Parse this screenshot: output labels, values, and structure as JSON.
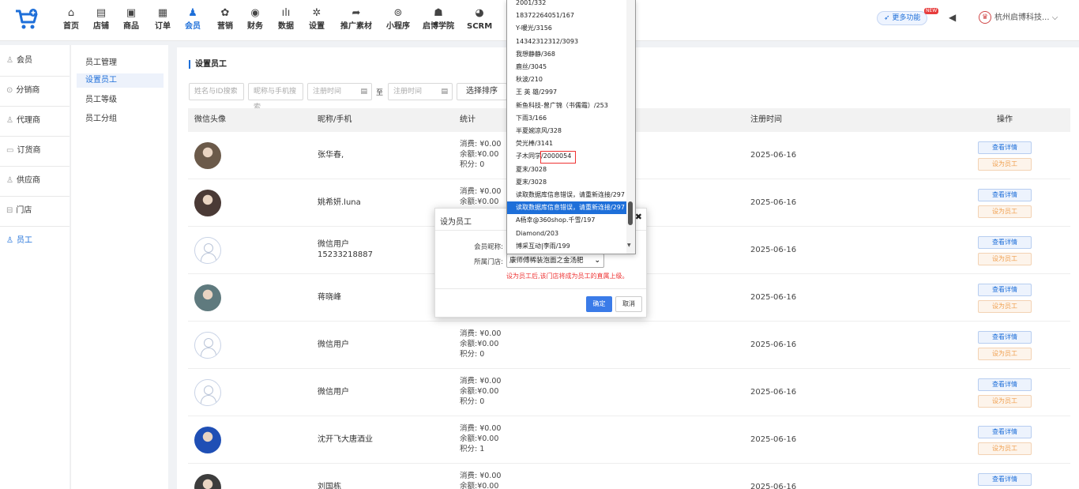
{
  "nav": {
    "items": [
      {
        "label": "首页",
        "icon": "home-icon",
        "glyph": "⌂"
      },
      {
        "label": "店铺",
        "icon": "shop-icon",
        "glyph": "▤"
      },
      {
        "label": "商品",
        "icon": "goods-icon",
        "glyph": "▣"
      },
      {
        "label": "订单",
        "icon": "order-icon",
        "glyph": "▦"
      },
      {
        "label": "会员",
        "icon": "members-icon",
        "glyph": "♟"
      },
      {
        "label": "营销",
        "icon": "marketing-icon",
        "glyph": "✿"
      },
      {
        "label": "财务",
        "icon": "finance-icon",
        "glyph": "◉"
      },
      {
        "label": "数据",
        "icon": "data-icon",
        "glyph": "ılı"
      },
      {
        "label": "设置",
        "icon": "settings-icon",
        "glyph": "✲"
      },
      {
        "label": "推广素材",
        "icon": "share-icon",
        "glyph": "➦"
      },
      {
        "label": "小程序",
        "icon": "miniprogram-icon",
        "glyph": "⊚"
      },
      {
        "label": "启博学院",
        "icon": "academy-icon",
        "glyph": "☗"
      },
      {
        "label": "SCRM",
        "icon": "scrm-icon",
        "glyph": "◕"
      }
    ],
    "more_label": "更多功能",
    "new_badge": "NEW",
    "company": "杭州启博科技..."
  },
  "sidebar1": [
    {
      "label": "会员",
      "icon": "member-icon",
      "glyph": "♙"
    },
    {
      "label": "分销商",
      "icon": "distributor-icon",
      "glyph": "⊙"
    },
    {
      "label": "代理商",
      "icon": "agent-icon",
      "glyph": "♙"
    },
    {
      "label": "订货商",
      "icon": "orderer-icon",
      "glyph": "▭"
    },
    {
      "label": "供应商",
      "icon": "supplier-icon",
      "glyph": "♙"
    },
    {
      "label": "门店",
      "icon": "store-icon",
      "glyph": "⊟"
    },
    {
      "label": "员工",
      "icon": "staff-icon",
      "glyph": "♙"
    }
  ],
  "sidebar2": [
    "员工管理",
    "设置员工",
    "员工等级",
    "员工分组"
  ],
  "page": {
    "title": "设置员工",
    "filters": {
      "id_placeholder": "姓名与ID搜索",
      "nick_placeholder": "昵称与手机搜索",
      "date_start": "注册时间",
      "date_end": "注册时间",
      "to": "至",
      "sort": "选择排序"
    },
    "columns": [
      "微信头像",
      "昵称/手机",
      "统计",
      "注册时间",
      "操作"
    ]
  },
  "rows": [
    {
      "nick": "张华春,",
      "phone": "",
      "consume": "消费: ¥0.00",
      "balance": "余额:¥0.00",
      "points": "积分: 0",
      "date": "2025-06-16",
      "avatar": "photo",
      "color": "#6b5a4a"
    },
    {
      "nick": "姚希妍.luna",
      "phone": "",
      "consume": "消费: ¥0.00",
      "balance": "余额:¥0.00",
      "points": "",
      "date": "2025-06-16",
      "avatar": "photo",
      "color": "#4a3a36"
    },
    {
      "nick": "微信用户",
      "phone": "15233218887",
      "consume": "",
      "balance": "",
      "points": "",
      "date": "2025-06-16",
      "avatar": "placeholder",
      "color": ""
    },
    {
      "nick": "蒋晓峰",
      "phone": "",
      "consume": "",
      "balance": "",
      "points": "",
      "date": "2025-06-16",
      "avatar": "photo",
      "color": "#5f7a7e"
    },
    {
      "nick": "微信用户",
      "phone": "",
      "consume": "消费: ¥0.00",
      "balance": "余额:¥0.00",
      "points": "积分: 0",
      "date": "2025-06-16",
      "avatar": "placeholder",
      "color": ""
    },
    {
      "nick": "微信用户",
      "phone": "",
      "consume": "消费: ¥0.00",
      "balance": "余额:¥0.00",
      "points": "积分: 0",
      "date": "2025-06-16",
      "avatar": "placeholder",
      "color": ""
    },
    {
      "nick": "沈开飞大唐酒业",
      "phone": "",
      "consume": "消费: ¥0.00",
      "balance": "余额:¥0.00",
      "points": "积分: 1",
      "date": "2025-06-16",
      "avatar": "photo",
      "color": "#1f4fb5"
    },
    {
      "nick": "刘国栋",
      "phone": "",
      "consume": "消费: ¥0.00",
      "balance": "余额:¥0.00",
      "points": "",
      "date": "2025-06-16",
      "avatar": "photo",
      "color": "#3d3d3d"
    }
  ],
  "row_actions": {
    "view": "查看详情",
    "set": "设为员工"
  },
  "modal": {
    "title": "设为员工",
    "nick_label": "会员昵称:",
    "store_label": "所属门店:",
    "store_value": "康师傅稀装泡面之金汤肥",
    "hint": "设为员工后,该门店将成为员工的直属上级。",
    "ok": "确定",
    "cancel": "取消"
  },
  "dropdown": {
    "options": [
      "2001/332",
      "18372264051/167",
      "Y-暖光/3156",
      "14342312312/3093",
      "我想静静/368",
      "鹿丝/3045",
      "秋波/210",
      "王 英 雄/2997",
      "新鱼科技-曾广锦（书儒霜）/253",
      "下雨3/166",
      "半夏婉凉风/328",
      "荧光棒/3141",
      "子木同学/2000054",
      "夏末/3028",
      "夏末/3028",
      "读取数据库信息错误，请重新连接/297",
      "读取数据库信息错误，请重新连接/297",
      "A杨幸@360shop.千雪/197",
      "Diamond/203",
      "博采互动|李雨/199"
    ],
    "selected_index": 16
  }
}
